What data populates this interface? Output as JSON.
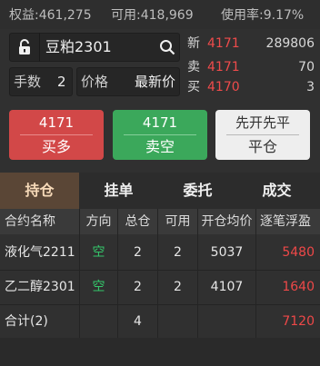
{
  "account": {
    "equity": "权益:461,275",
    "available": "可用:418,969",
    "usage": "使用率:9.17%"
  },
  "order_form": {
    "symbol": "豆粕2301",
    "qty_label": "手数",
    "qty_value": "2",
    "price_label": "价格",
    "price_mode": "最新价"
  },
  "quotes": [
    {
      "label": "新",
      "price": "4171",
      "value": "289806"
    },
    {
      "label": "卖",
      "price": "4171",
      "value": "70"
    },
    {
      "label": "买",
      "price": "4170",
      "value": "3"
    }
  ],
  "actions": {
    "buy": {
      "price": "4171",
      "label": "买多"
    },
    "sell": {
      "price": "4171",
      "label": "卖空"
    },
    "close": {
      "mode": "先开先平",
      "label": "平仓"
    }
  },
  "tabs": [
    "持仓",
    "挂单",
    "委托",
    "成交"
  ],
  "table": {
    "headers": [
      "合约名称",
      "方向",
      "总仓",
      "可用",
      "开仓均价",
      "逐笔浮盈"
    ],
    "rows": [
      {
        "name": "液化气2211",
        "direction": "空",
        "total": "2",
        "available": "2",
        "avg_price": "5037",
        "pnl": "5480"
      },
      {
        "name": "乙二醇2301",
        "direction": "空",
        "total": "2",
        "available": "2",
        "avg_price": "4107",
        "pnl": "1640"
      }
    ],
    "summary": {
      "label": "合计(2)",
      "total": "4",
      "pnl": "7120"
    }
  },
  "colors": {
    "up": "#ef4b4b",
    "short": "#34c66a",
    "buy_button": "#d24848",
    "sell_button": "#3ba85b",
    "active_tab": "#5a4636"
  }
}
